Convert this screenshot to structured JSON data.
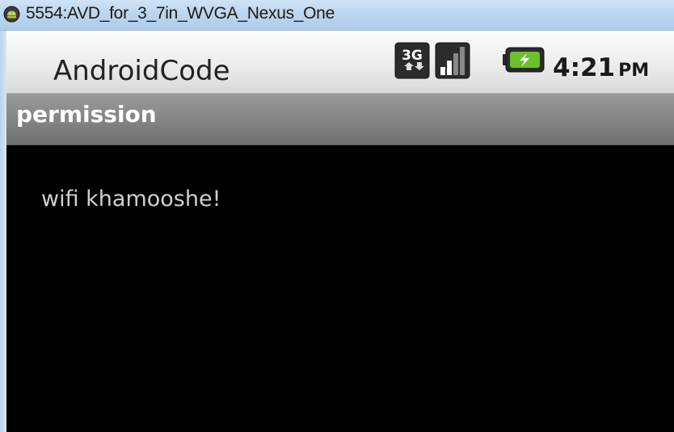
{
  "window": {
    "title": "5554:AVD_for_3_7in_WVGA_Nexus_One",
    "icon": "android-emulator-icon"
  },
  "status_bar": {
    "app_title": "AndroidCode",
    "network_icon": "3g-data-icon",
    "signal_icon": "signal-strength-icon",
    "battery_icon": "battery-charging-icon",
    "time": "4:21",
    "ampm": "PM"
  },
  "activity": {
    "title": "permission"
  },
  "content": {
    "message": "wifi khamooshe!"
  },
  "colors": {
    "titlebar": "#bcd6ef",
    "status_bar": "#ececec",
    "activity_bar": "#858585",
    "content_bg": "#000000",
    "content_text": "#d0d0d0",
    "battery_accent": "#6cc02a"
  }
}
